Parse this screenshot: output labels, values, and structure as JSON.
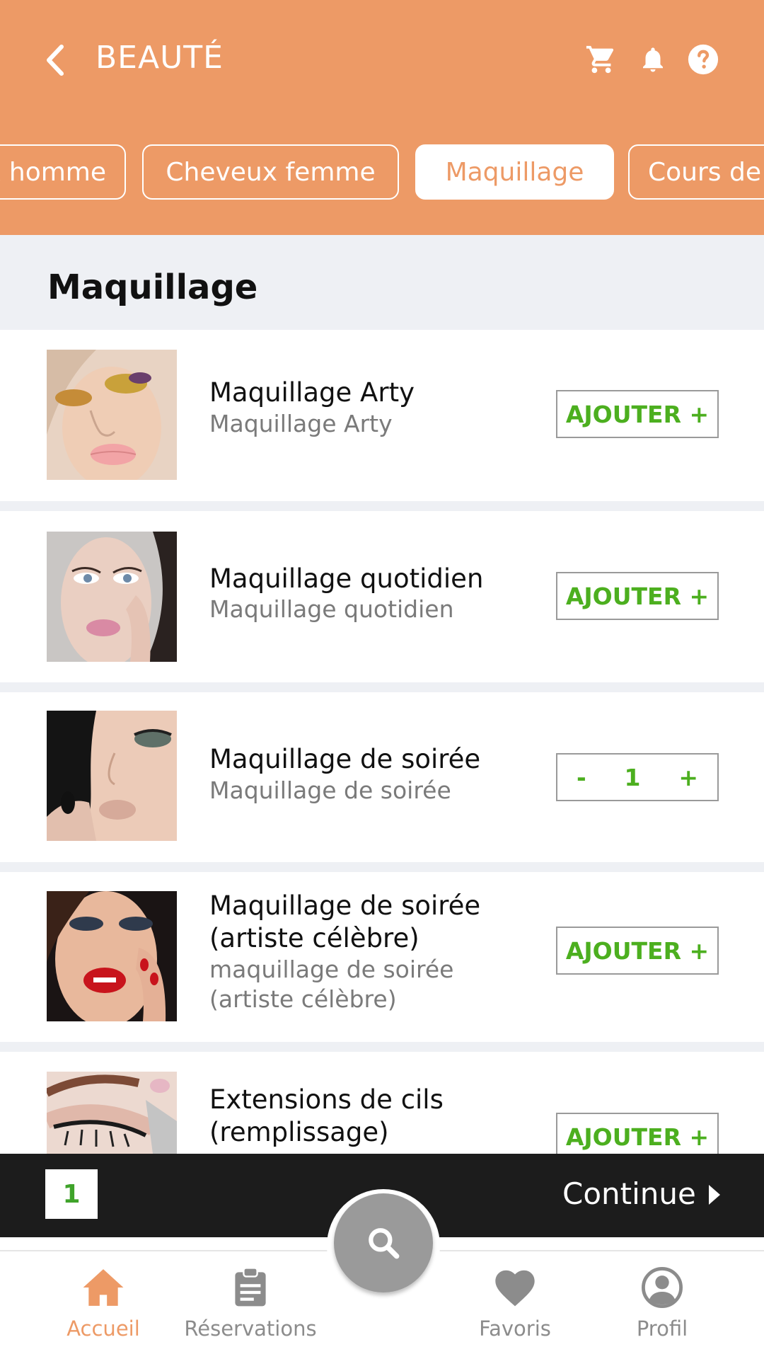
{
  "header": {
    "title": "BEAUTÉ",
    "icons": [
      "back-icon",
      "cart-icon",
      "bell-icon",
      "help-icon"
    ],
    "accent_color": "#ED9A66"
  },
  "categories": [
    {
      "label": "x homme",
      "active": false
    },
    {
      "label": "Cheveux femme",
      "active": false
    },
    {
      "label": "Maquillage",
      "active": true
    },
    {
      "label": "Cours de",
      "active": false
    }
  ],
  "section": {
    "title": "Maquillage"
  },
  "items": [
    {
      "name": "Maquillage Arty",
      "desc": "Maquillage Arty",
      "action": "AJOUTER +"
    },
    {
      "name": "Maquillage quotidien",
      "desc": "Maquillage quotidien",
      "action": "AJOUTER +"
    },
    {
      "name": "Maquillage de soirée",
      "desc": "Maquillage de soirée",
      "qty": "1",
      "minus": "-",
      "plus": "+"
    },
    {
      "name": "Maquillage de soirée (artiste célèbre)",
      "desc": " maquillage de soirée (artiste célèbre)",
      "action": "AJOUTER +"
    },
    {
      "name": "Extensions de cils (remplissage)",
      "action": "AJOUTER +"
    }
  ],
  "cart": {
    "count": "1",
    "continue_label": "Continue"
  },
  "nav": {
    "home": "Accueil",
    "reservations": "Réservations",
    "favorites": "Favoris",
    "profile": "Profil"
  }
}
